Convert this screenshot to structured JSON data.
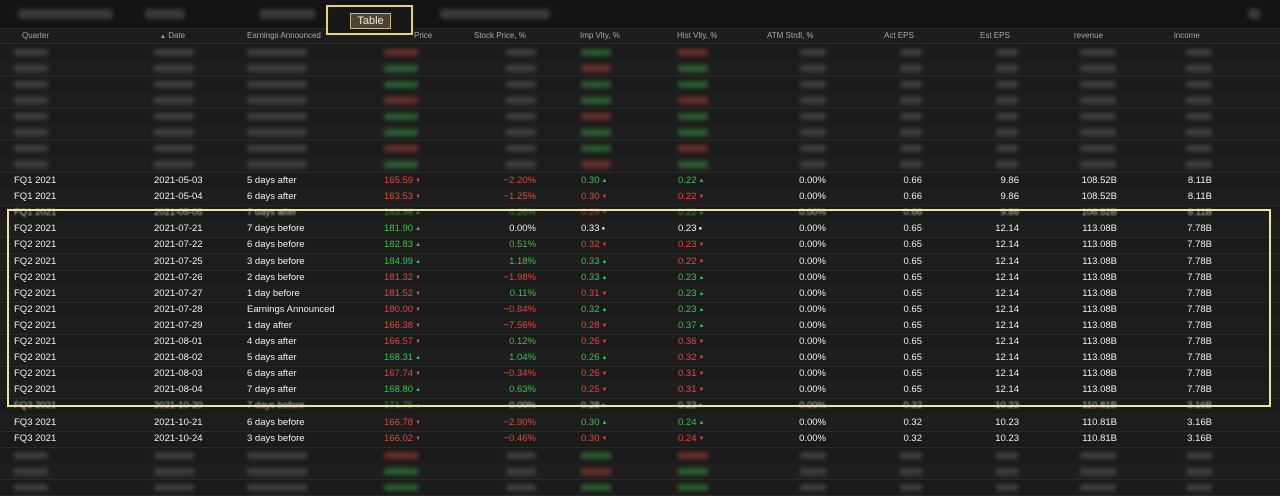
{
  "toolbar": {
    "table_label": "Table"
  },
  "columns": [
    "Quarter",
    "Date",
    "Earnings Announced",
    "Price",
    "Stock Price, %",
    "Imp Vlty, %",
    "Hist Vlty, %",
    "ATM Strdl, %",
    "Act EPS",
    "Est EPS",
    "revenue",
    "income"
  ],
  "sort_indicator": "▲",
  "rows": [
    {
      "q": "FQ1 2021",
      "date": "2021-05-03",
      "ea": "5 days after",
      "price": "165.59",
      "pc": "red",
      "sp": "−2.20%",
      "spc": "red",
      "iv": "0.30",
      "ivc": "green",
      "hv": "0.22",
      "hvc": "green",
      "atm": "0.00%",
      "act": "0.66",
      "est": "9.86",
      "rev": "108.52B",
      "inc": "8.11B"
    },
    {
      "q": "FQ1 2021",
      "date": "2021-05-04",
      "ea": "6 days after",
      "price": "163.53",
      "pc": "red",
      "sp": "−1.25%",
      "spc": "red",
      "iv": "0.30",
      "ivc": "red",
      "hv": "0.22",
      "hvc": "red",
      "atm": "0.00%",
      "act": "0.66",
      "est": "9.86",
      "rev": "108.52B",
      "inc": "8.11B"
    },
    {
      "q": "FQ1 2021",
      "date": "2021-05-05",
      "ea": "7 days after",
      "price": "163.96",
      "pc": "green",
      "sp": "0.26%",
      "spc": "green",
      "iv": "0.29",
      "ivc": "red",
      "hv": "0.22",
      "hvc": "green",
      "atm": "0.00%",
      "act": "0.66",
      "est": "9.86",
      "rev": "108.52B",
      "inc": "8.11B",
      "fade": true
    },
    {
      "q": "FQ2 2021",
      "date": "2021-07-21",
      "ea": "7 days before",
      "price": "181.90",
      "pc": "green",
      "sp": "0.00%",
      "spc": "white",
      "iv": "0.33",
      "ivc": "white",
      "hv": "0.23",
      "hvc": "white",
      "atm": "0.00%",
      "act": "0.65",
      "est": "12.14",
      "rev": "113.08B",
      "inc": "7.78B"
    },
    {
      "q": "FQ2 2021",
      "date": "2021-07-22",
      "ea": "6 days before",
      "price": "182.83",
      "pc": "green",
      "sp": "0.51%",
      "spc": "green",
      "iv": "0.32",
      "ivc": "red",
      "hv": "0.23",
      "hvc": "red",
      "atm": "0.00%",
      "act": "0.65",
      "est": "12.14",
      "rev": "113.08B",
      "inc": "7.78B"
    },
    {
      "q": "FQ2 2021",
      "date": "2021-07-25",
      "ea": "3 days before",
      "price": "184.99",
      "pc": "green",
      "sp": "1.18%",
      "spc": "green",
      "iv": "0.33",
      "ivc": "green",
      "hv": "0.22",
      "hvc": "red",
      "atm": "0.00%",
      "act": "0.65",
      "est": "12.14",
      "rev": "113.08B",
      "inc": "7.78B"
    },
    {
      "q": "FQ2 2021",
      "date": "2021-07-26",
      "ea": "2 days before",
      "price": "181.32",
      "pc": "red",
      "sp": "−1.98%",
      "spc": "red",
      "iv": "0.33",
      "ivc": "green",
      "hv": "0.23",
      "hvc": "green",
      "atm": "0.00%",
      "act": "0.65",
      "est": "12.14",
      "rev": "113.08B",
      "inc": "7.78B"
    },
    {
      "q": "FQ2 2021",
      "date": "2021-07-27",
      "ea": "1 day before",
      "price": "181.52",
      "pc": "red",
      "sp": "0.11%",
      "spc": "green",
      "iv": "0.31",
      "ivc": "red",
      "hv": "0.23",
      "hvc": "green",
      "atm": "0.00%",
      "act": "0.65",
      "est": "12.14",
      "rev": "113.08B",
      "inc": "7.78B"
    },
    {
      "q": "FQ2 2021",
      "date": "2021-07-28",
      "ea": "Earnings Announced",
      "price": "180.00",
      "pc": "red",
      "sp": "−0.84%",
      "spc": "red",
      "iv": "0.32",
      "ivc": "green",
      "hv": "0.23",
      "hvc": "green",
      "atm": "0.00%",
      "act": "0.65",
      "est": "12.14",
      "rev": "113.08B",
      "inc": "7.78B"
    },
    {
      "q": "FQ2 2021",
      "date": "2021-07-29",
      "ea": "1 day after",
      "price": "166.38",
      "pc": "red",
      "sp": "−7.56%",
      "spc": "red",
      "iv": "0.28",
      "ivc": "red",
      "hv": "0.37",
      "hvc": "green",
      "atm": "0.00%",
      "act": "0.65",
      "est": "12.14",
      "rev": "113.08B",
      "inc": "7.78B"
    },
    {
      "q": "FQ2 2021",
      "date": "2021-08-01",
      "ea": "4 days after",
      "price": "166.57",
      "pc": "red",
      "sp": "0.12%",
      "spc": "green",
      "iv": "0.26",
      "ivc": "red",
      "hv": "0.36",
      "hvc": "red",
      "atm": "0.00%",
      "act": "0.65",
      "est": "12.14",
      "rev": "113.08B",
      "inc": "7.78B"
    },
    {
      "q": "FQ2 2021",
      "date": "2021-08-02",
      "ea": "5 days after",
      "price": "168.31",
      "pc": "green",
      "sp": "1.04%",
      "spc": "green",
      "iv": "0.26",
      "ivc": "green",
      "hv": "0.32",
      "hvc": "red",
      "atm": "0.00%",
      "act": "0.65",
      "est": "12.14",
      "rev": "113.08B",
      "inc": "7.78B"
    },
    {
      "q": "FQ2 2021",
      "date": "2021-08-03",
      "ea": "6 days after",
      "price": "167.74",
      "pc": "red",
      "sp": "−0.34%",
      "spc": "red",
      "iv": "0.26",
      "ivc": "red",
      "hv": "0.31",
      "hvc": "red",
      "atm": "0.00%",
      "act": "0.65",
      "est": "12.14",
      "rev": "113.08B",
      "inc": "7.78B"
    },
    {
      "q": "FQ2 2021",
      "date": "2021-08-04",
      "ea": "7 days after",
      "price": "168.80",
      "pc": "green",
      "sp": "0.63%",
      "spc": "green",
      "iv": "0.25",
      "ivc": "red",
      "hv": "0.31",
      "hvc": "red",
      "atm": "0.00%",
      "act": "0.65",
      "est": "12.14",
      "rev": "113.08B",
      "inc": "7.78B"
    },
    {
      "q": "FQ3 2021",
      "date": "2021-10-20",
      "ea": "7 days before",
      "price": "171.75",
      "pc": "green",
      "sp": "0.00%",
      "spc": "white",
      "iv": "0.28",
      "ivc": "white",
      "hv": "0.23",
      "hvc": "white",
      "atm": "0.00%",
      "act": "0.32",
      "est": "10.23",
      "rev": "110.81B",
      "inc": "3.16B",
      "fade": true
    },
    {
      "q": "FQ3 2021",
      "date": "2021-10-21",
      "ea": "6 days before",
      "price": "166.78",
      "pc": "red",
      "sp": "−2.90%",
      "spc": "red",
      "iv": "0.30",
      "ivc": "green",
      "hv": "0.24",
      "hvc": "green",
      "atm": "0.00%",
      "act": "0.32",
      "est": "10.23",
      "rev": "110.81B",
      "inc": "3.16B"
    },
    {
      "q": "FQ3 2021",
      "date": "2021-10-24",
      "ea": "3 days before",
      "price": "166.02",
      "pc": "red",
      "sp": "−0.46%",
      "spc": "red",
      "iv": "0.30",
      "ivc": "red",
      "hv": "0.24",
      "hvc": "red",
      "atm": "0.00%",
      "act": "0.32",
      "est": "10.23",
      "rev": "110.81B",
      "inc": "3.16B"
    }
  ]
}
